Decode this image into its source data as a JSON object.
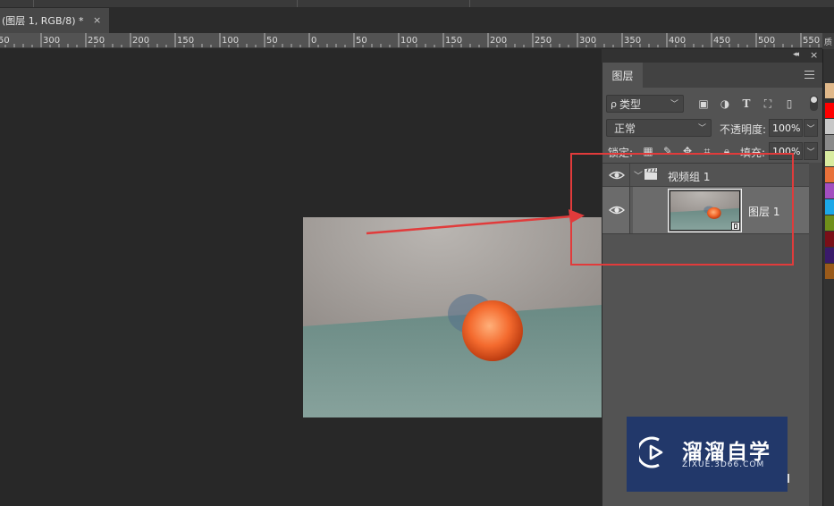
{
  "document_tab": {
    "title": "(图层 1, RGB/8) *",
    "close": "×"
  },
  "ruler": {
    "labels": [
      "50",
      "300",
      "250",
      "200",
      "150",
      "100",
      "50",
      "0",
      "50",
      "100",
      "150",
      "200",
      "250",
      "300",
      "350",
      "400",
      "450",
      "500",
      "550"
    ]
  },
  "dock": {
    "collapse_icon": "collapse-arrows-icon",
    "close": "×"
  },
  "layers_panel": {
    "tab_label": "图层",
    "kind_filter": "类型",
    "kind_filter_prefix": "ρ",
    "blend_mode": "正常",
    "opacity_label": "不透明度:",
    "opacity_value": "100%",
    "lock_label": "锁定:",
    "fill_label": "填充:",
    "fill_value": "100%",
    "filter_icons": [
      "image-filter-icon",
      "adjustment-filter-icon",
      "type-filter-icon",
      "shape-filter-icon",
      "smart-object-filter-icon"
    ],
    "lock_icons": [
      "lock-pixels-grid-icon",
      "lock-paint-brush-icon",
      "lock-position-move-icon",
      "lock-artboard-icon",
      "lock-all-icon"
    ],
    "layers": [
      {
        "name": "视频组 1",
        "kind": "video-group",
        "visible": true,
        "selected": false
      },
      {
        "name": "图层 1",
        "kind": "video-layer",
        "visible": true,
        "selected": true
      }
    ]
  },
  "swatches": {
    "header": "质",
    "colors": [
      "#e0b88a",
      "#ff0000",
      "#c8c8c8",
      "#8a8a8a",
      "#d8eba0",
      "#e8713a",
      "#a24ec0",
      "#1ca8e8",
      "#6f8f1a",
      "#7a0f18",
      "#3a1a6a",
      "#9a5a1a"
    ]
  },
  "watermark": {
    "brand": "溜溜自学",
    "url": "ZIXUE.3D66.COM"
  },
  "colors": {
    "annotation_red": "#e13b3b",
    "panel_bg": "#535353",
    "selected_layer_bg": "#6b6b6b"
  }
}
